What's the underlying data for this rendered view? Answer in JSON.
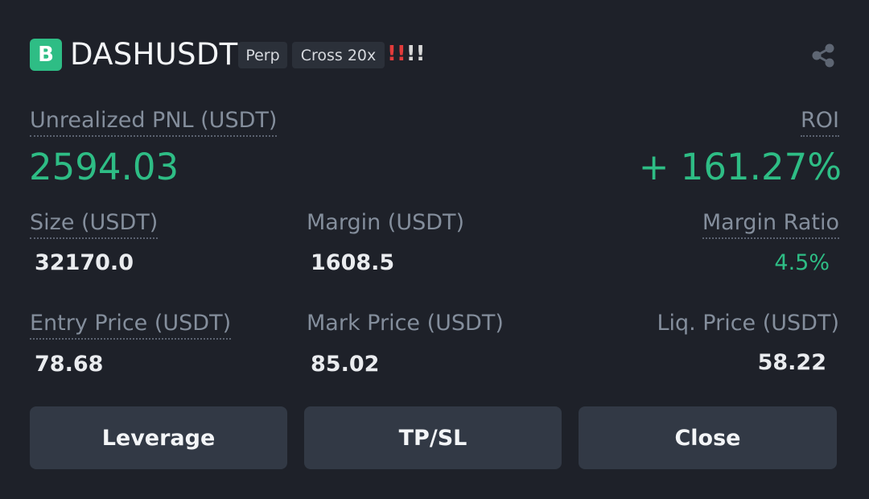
{
  "header": {
    "coin_badge": "B",
    "symbol": "DASHUSDT",
    "tag_type": "Perp",
    "tag_margin": "Cross 20x",
    "warning_red": "!!",
    "warning_white": "!!",
    "share_icon": "share-icon"
  },
  "pnl": {
    "label": "Unrealized PNL (USDT)",
    "value": "2594.03"
  },
  "roi": {
    "label": "ROI",
    "value": "+ 161.27%"
  },
  "size": {
    "label": "Size (USDT)",
    "value": "32170.0"
  },
  "margin": {
    "label": "Margin (USDT)",
    "value": "1608.5"
  },
  "margin_ratio": {
    "label": "Margin Ratio",
    "value": "4.5%"
  },
  "entry_price": {
    "label": "Entry Price (USDT)",
    "value": "78.68"
  },
  "mark_price": {
    "label": "Mark Price (USDT)",
    "value": "85.02"
  },
  "liq_price": {
    "label": "Liq. Price (USDT)",
    "value": "58.22"
  },
  "buttons": {
    "leverage": "Leverage",
    "tpsl": "TP/SL",
    "close": "Close"
  },
  "colors": {
    "background": "#1e2129",
    "profit": "#2ebd85",
    "button": "#323945",
    "label": "#848e9c",
    "warning": "#e23b3b"
  }
}
